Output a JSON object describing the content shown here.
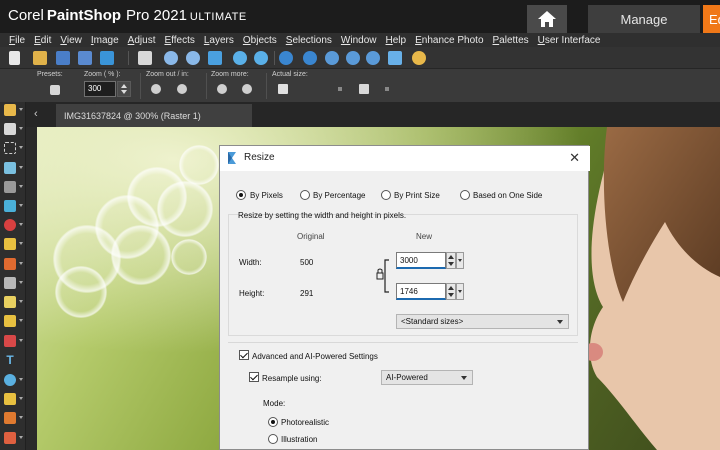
{
  "app": {
    "brand_corel": "Corel",
    "brand_product": "PaintShop",
    "brand_pro": "Pro 2021",
    "brand_edition": "ULTIMATE",
    "tab_manage": "Manage",
    "tab_edit": "Ed"
  },
  "menu": [
    "File",
    "Edit",
    "View",
    "Image",
    "Adjust",
    "Effects",
    "Layers",
    "Objects",
    "Selections",
    "Window",
    "Help",
    "Enhance Photo",
    "Palettes",
    "User Interface"
  ],
  "tool_options": {
    "presets_label": "Presets:",
    "zoom_label": "Zoom ( % ):",
    "zoom_value": "300",
    "zoom_out_in_label": "Zoom out / in:",
    "zoom_more_label": "Zoom more:",
    "actual_size_label": "Actual size:"
  },
  "document_tab": {
    "label": "IMG31637824 @ 300% (Raster 1)",
    "nav_icon": "chevron-left-icon"
  },
  "dialog": {
    "title": "Resize",
    "close_glyph": "✕",
    "modes": [
      {
        "label": "By Pixels",
        "selected": true
      },
      {
        "label": "By Percentage",
        "selected": false
      },
      {
        "label": "By Print Size",
        "selected": false
      },
      {
        "label": "Based on One Side",
        "selected": false
      }
    ],
    "instruction": "Resize by setting the width and height in pixels.",
    "col_original": "Original",
    "col_new": "New",
    "width_label": "Width:",
    "width_original": "500",
    "width_new": "3000",
    "height_label": "Height:",
    "height_original": "291",
    "height_new": "1746",
    "standard_sizes": "<Standard sizes>",
    "advanced_label": "Advanced and AI-Powered Settings",
    "advanced_checked": true,
    "resample_label": "Resample using:",
    "resample_checked": true,
    "resample_value": "AI-Powered",
    "mode_label": "Mode:",
    "mode_options": [
      {
        "label": "Photorealistic",
        "selected": true
      },
      {
        "label": "Illustration",
        "selected": false
      }
    ]
  },
  "colors": {
    "accent_orange": "#f07818",
    "titlebar_bg": "#1c1c1c",
    "dialog_bg": "#f0f0f0",
    "field_focus": "#1c6ab0"
  }
}
